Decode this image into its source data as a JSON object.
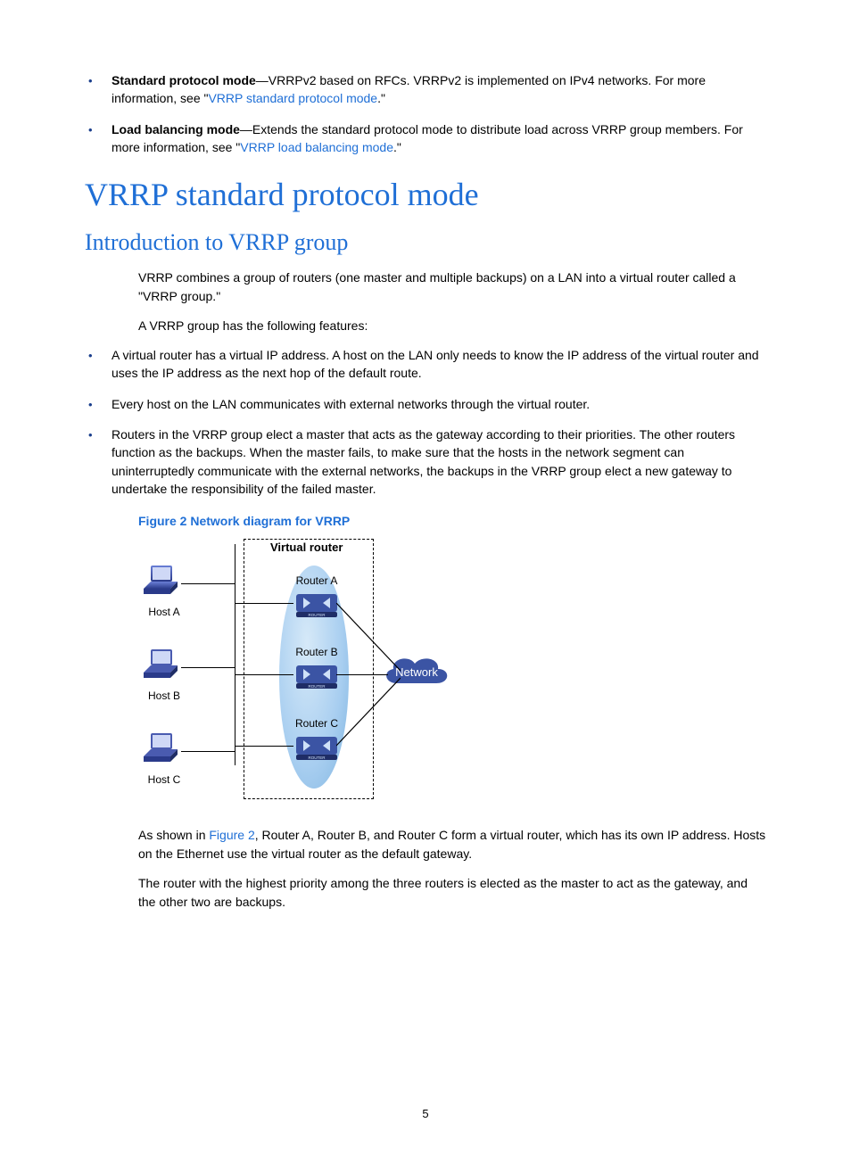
{
  "topBullets": [
    {
      "boldLead": "Standard protocol mode",
      "textA": "—VRRPv2 based on RFCs. VRRPv2 is implemented on IPv4 networks. For more information, see \"",
      "link": "VRRP standard protocol mode",
      "textB": ".\""
    },
    {
      "boldLead": "Load balancing mode",
      "textA": "—Extends the standard protocol mode to distribute load across VRRP group members. For more information, see \"",
      "link": "VRRP load balancing mode",
      "textB": ".\""
    }
  ],
  "h1": "VRRP standard protocol mode",
  "h2": "Introduction to VRRP group",
  "introPara": "VRRP combines a group of routers (one master and multiple backups) on a LAN into a virtual router called a \"VRRP group.\"",
  "featuresLead": "A VRRP group has the following features:",
  "featuresBullets": [
    "A virtual router has a virtual IP address. A host on the LAN only needs to know the IP address of the virtual router and uses the IP address as the next hop of the default route.",
    "Every host on the LAN communicates with external networks through the virtual router.",
    "Routers in the VRRP group elect a master that acts as the gateway according to their priorities. The other routers function as the backups. When the master fails, to make sure that the hosts in the network segment can uninterruptedly communicate with the external networks, the backups in the VRRP group elect a new gateway to undertake the responsibility of the failed master."
  ],
  "figCaption": "Figure 2 Network diagram for VRRP",
  "figure": {
    "virtualRouter": "Virtual router",
    "hostA": "Host A",
    "hostB": "Host B",
    "hostC": "Host C",
    "routerA": "Router A",
    "routerB": "Router B",
    "routerC": "Router C",
    "network": "Network"
  },
  "afterFigA_pre": "As shown in ",
  "afterFigA_link": "Figure 2",
  "afterFigA_post": ", Router A, Router B, and Router C form a virtual router, which has its own IP address. Hosts on the Ethernet use the virtual router as the default gateway.",
  "afterFigB": "The router with the highest priority among the three routers is elected as the master to act as the gateway, and the other two are backups.",
  "pageNumber": "5"
}
